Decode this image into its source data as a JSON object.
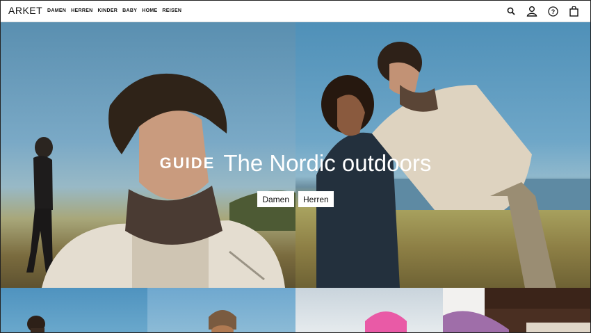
{
  "brand": {
    "logo": "ARKET"
  },
  "nav": {
    "items": [
      {
        "label": "DAMEN"
      },
      {
        "label": "HERREN"
      },
      {
        "label": "KINDER"
      },
      {
        "label": "BABY"
      },
      {
        "label": "HOME"
      },
      {
        "label": "REISEN"
      }
    ]
  },
  "header_icons": [
    "search-icon",
    "account-icon",
    "help-icon",
    "bag-icon"
  ],
  "hero": {
    "tag": "GUIDE",
    "title": "The Nordic outdoors",
    "buttons": [
      {
        "label": "Damen"
      },
      {
        "label": "Herren"
      }
    ]
  },
  "colors": {
    "text": "#111111",
    "header_bg": "#ffffff",
    "sky": "#6fa7c8"
  }
}
